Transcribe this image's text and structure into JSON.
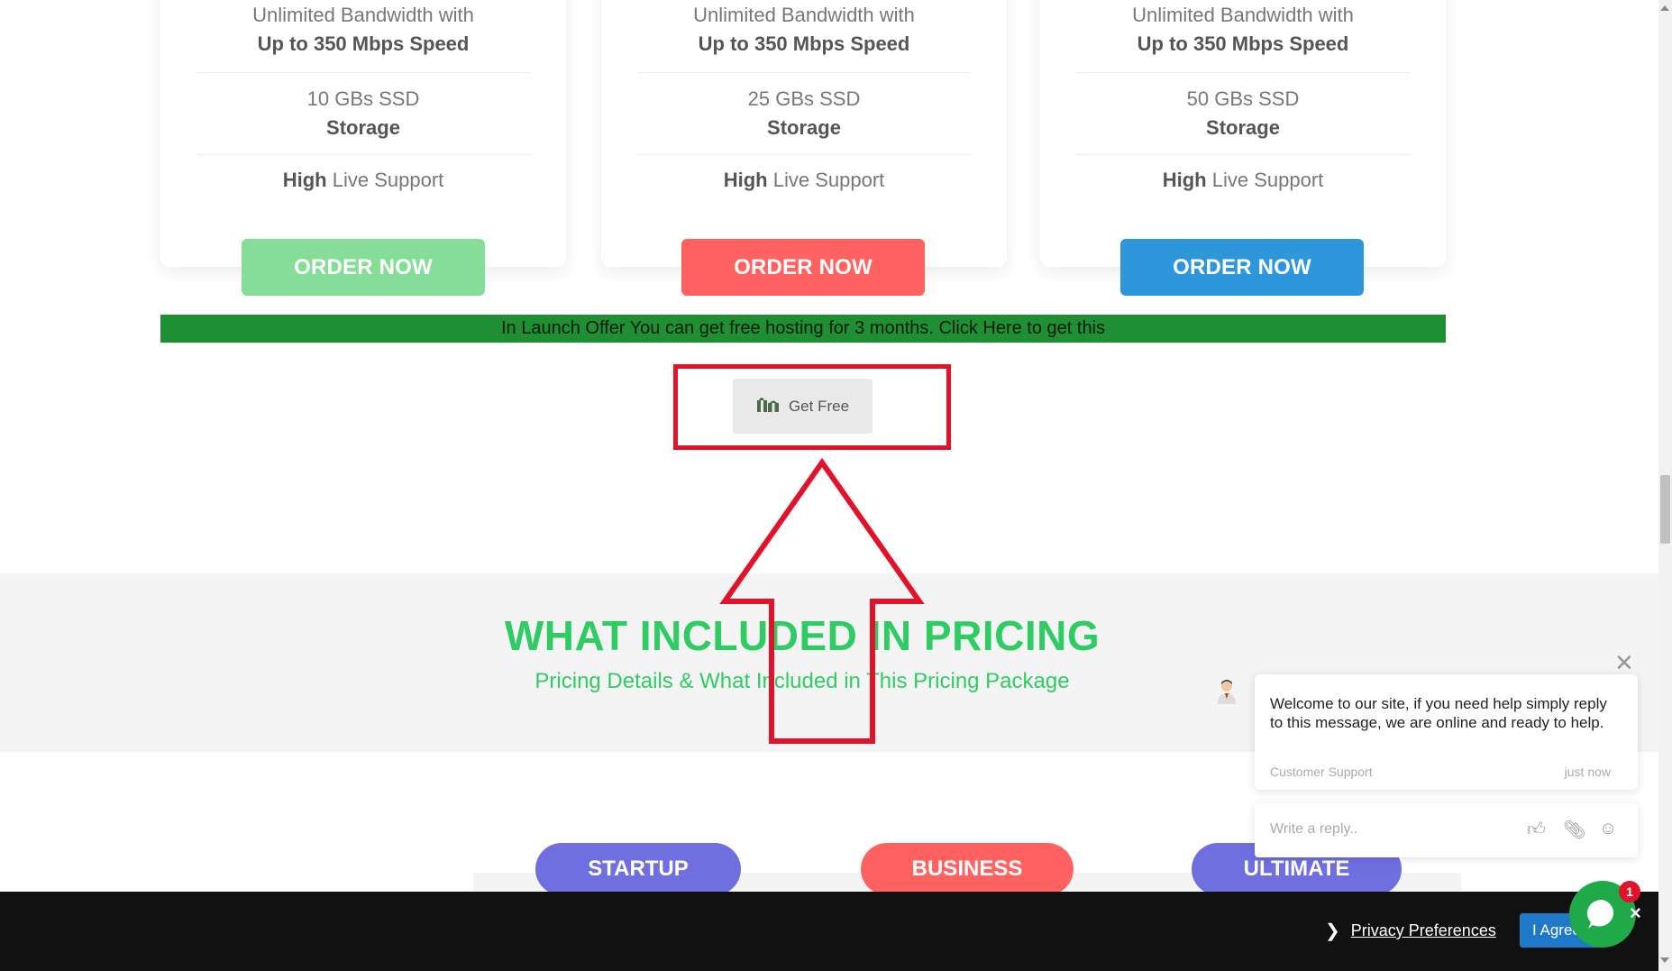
{
  "pricing_cards": [
    {
      "bandwidth_line1": "Unlimited Bandwidth with",
      "bandwidth_line2": "Up to 350 Mbps Speed",
      "storage_line1": "10 GBs SSD",
      "storage_line2": "Storage",
      "support_bold": "High",
      "support_rest": " Live Support",
      "button_label": "ORDER NOW",
      "button_color": "#86dd98"
    },
    {
      "bandwidth_line1": "Unlimited Bandwidth with",
      "bandwidth_line2": "Up to 350 Mbps Speed",
      "storage_line1": "25 GBs SSD",
      "storage_line2": "Storage",
      "support_bold": "High",
      "support_rest": " Live Support",
      "button_label": "ORDER NOW",
      "button_color": "#ff6260"
    },
    {
      "bandwidth_line1": "Unlimited Bandwidth with",
      "bandwidth_line2": "Up to 350 Mbps Speed",
      "storage_line1": "50 GBs SSD",
      "storage_line2": "Storage",
      "support_bold": "High",
      "support_rest": " Live Support",
      "button_label": "ORDER NOW",
      "button_color": "#2e96da"
    }
  ],
  "offer_banner": {
    "text": "In Launch Offer You can get free hosting for 3 months. Click Here to get this",
    "background": "#1f8f34"
  },
  "get_free_button": {
    "label": "Get Free",
    "icon": "gift-box-icon"
  },
  "annotation": {
    "color": "#e0132a"
  },
  "included_section": {
    "title": "WHAT INCLUDED IN PRICING",
    "subtitle": "Pricing Details & What Included in This Pricing Package",
    "accent": "#2ecc63"
  },
  "plan_tabs": [
    {
      "label": "STARTUP",
      "color": "#6f6fe0"
    },
    {
      "label": "BUSINESS",
      "color": "#ff6260"
    },
    {
      "label": "ULTIMATE",
      "color": "#6f6fe0"
    }
  ],
  "chat": {
    "message": "Welcome to our site, if you need help simply reply to this message, we are online and ready to help.",
    "sender": "Customer Support",
    "time": "just now",
    "reply_placeholder": "Write a reply..",
    "badge_count": "1",
    "launcher_color": "#1faa4a"
  },
  "cookie_bar": {
    "privacy_label": "Privacy Preferences",
    "agree_label": "I Agree"
  }
}
